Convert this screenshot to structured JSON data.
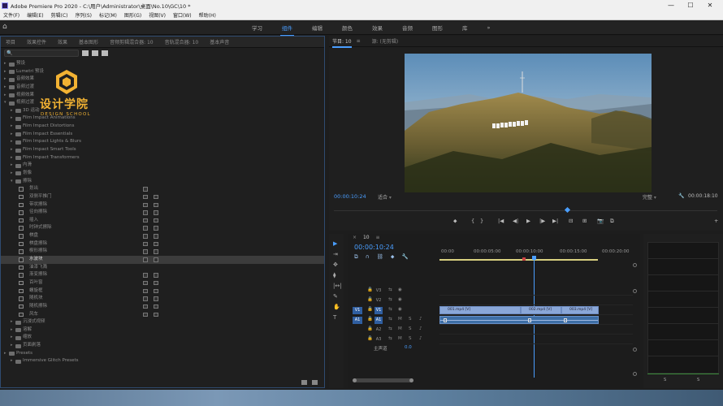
{
  "window": {
    "title": "Adobe Premiere Pro 2020 - C:\\用户\\Administrator\\桌面\\No.10\\GC\\10 *",
    "buttons": [
      "—",
      "☐",
      "✕"
    ]
  },
  "menu": [
    "文件(F)",
    "编辑(E)",
    "剪辑(C)",
    "序列(S)",
    "标记(M)",
    "图形(G)",
    "视图(V)",
    "窗口(W)",
    "帮助(H)"
  ],
  "workspaces": [
    {
      "label": "学习"
    },
    {
      "label": "组件",
      "active": true
    },
    {
      "label": "编辑"
    },
    {
      "label": "颜色"
    },
    {
      "label": "效果"
    },
    {
      "label": "音频"
    },
    {
      "label": "图形"
    },
    {
      "label": "库"
    },
    {
      "label": "»"
    }
  ],
  "effects_panel": {
    "tabs": [
      "项目",
      "效果控件",
      "效果",
      "基本图形",
      "音频剪辑混合器: 10",
      "音轨混合器: 10",
      "基本声音"
    ],
    "tree": [
      {
        "indent": 0,
        "type": "folder",
        "label": "预设"
      },
      {
        "indent": 0,
        "type": "folder",
        "label": "Lumetri 预设"
      },
      {
        "indent": 0,
        "type": "folder",
        "label": "音频效果"
      },
      {
        "indent": 0,
        "type": "folder",
        "label": "音频过渡"
      },
      {
        "indent": 0,
        "type": "folder",
        "label": "视频效果"
      },
      {
        "indent": 0,
        "type": "folder",
        "label": "视频过渡",
        "open": true
      },
      {
        "indent": 1,
        "type": "folder",
        "label": "3D 运动"
      },
      {
        "indent": 1,
        "type": "folder",
        "label": "Film Impact Animations"
      },
      {
        "indent": 1,
        "type": "folder",
        "label": "Film Impact Distortions"
      },
      {
        "indent": 1,
        "type": "folder",
        "label": "Film Impact Essentials"
      },
      {
        "indent": 1,
        "type": "folder",
        "label": "Film Impact Lights & Blurs"
      },
      {
        "indent": 1,
        "type": "folder",
        "label": "Film Impact Smart Tools"
      },
      {
        "indent": 1,
        "type": "folder",
        "label": "Film Impact Transformers"
      },
      {
        "indent": 1,
        "type": "folder",
        "label": "内滑"
      },
      {
        "indent": 1,
        "type": "folder",
        "label": "划像"
      },
      {
        "indent": 1,
        "type": "folder",
        "label": "擦除",
        "open": true
      },
      {
        "indent": 2,
        "type": "fx",
        "label": "划出",
        "badges": 1
      },
      {
        "indent": 2,
        "type": "fx",
        "label": "双侧平推门",
        "badges": 2
      },
      {
        "indent": 2,
        "type": "fx",
        "label": "带状擦除",
        "badges": 2
      },
      {
        "indent": 2,
        "type": "fx",
        "label": "径向擦除",
        "badges": 2
      },
      {
        "indent": 2,
        "type": "fx",
        "label": "插入",
        "badges": 2
      },
      {
        "indent": 2,
        "type": "fx",
        "label": "时钟式擦除",
        "badges": 2
      },
      {
        "indent": 2,
        "type": "fx",
        "label": "棋盘",
        "badges": 2
      },
      {
        "indent": 2,
        "type": "fx",
        "label": "棋盘擦除",
        "badges": 2
      },
      {
        "indent": 2,
        "type": "fx",
        "label": "楔形擦除",
        "badges": 2
      },
      {
        "indent": 2,
        "type": "fx",
        "label": "水波块",
        "badges": 2,
        "selected": true
      },
      {
        "indent": 2,
        "type": "fx",
        "label": "油漆飞溅",
        "badges": 0
      },
      {
        "indent": 2,
        "type": "fx",
        "label": "渐变擦除",
        "badges": 2
      },
      {
        "indent": 2,
        "type": "fx",
        "label": "百叶窗",
        "badges": 2
      },
      {
        "indent": 2,
        "type": "fx",
        "label": "螺旋框",
        "badges": 2
      },
      {
        "indent": 2,
        "type": "fx",
        "label": "随机块",
        "badges": 2
      },
      {
        "indent": 2,
        "type": "fx",
        "label": "随机擦除",
        "badges": 2
      },
      {
        "indent": 2,
        "type": "fx",
        "label": "风车",
        "badges": 2
      },
      {
        "indent": 1,
        "type": "folder",
        "label": "沉浸式视频"
      },
      {
        "indent": 1,
        "type": "folder",
        "label": "溶解"
      },
      {
        "indent": 1,
        "type": "folder",
        "label": "缩放"
      },
      {
        "indent": 1,
        "type": "folder",
        "label": "页面剥落"
      },
      {
        "indent": 0,
        "type": "folder",
        "label": "Presets"
      },
      {
        "indent": 1,
        "type": "folder",
        "label": "Immersive Glitch Presets"
      }
    ]
  },
  "logo": {
    "title": "设计学院",
    "subtitle": "DESIGN SCHOOL",
    "color": "#f2b233"
  },
  "program_monitor": {
    "tab_active": "节目: 10",
    "tab_menu": "≡",
    "tab_other": "源: (无剪辑)",
    "timecode": "00:00:10:24",
    "fit": "适合",
    "quality": "完整",
    "duration": "00:00:18:10",
    "playhead_fraction": 0.603,
    "controls": [
      "⬥",
      "{",
      "}",
      "|◀",
      "◀|",
      "▶",
      "|▶",
      "▶|",
      "⊟",
      "⊞",
      "📷",
      "⧉",
      "+"
    ]
  },
  "tools": [
    "▶",
    "⇥",
    "✥",
    "⧫",
    "|↔|",
    "✎",
    "✋",
    "T"
  ],
  "timeline": {
    "tab_close": "×",
    "tab_menu": "≡",
    "tab": "10",
    "timecode": "00:00:10:24",
    "ruler": [
      "00:00",
      "00:00:05:00",
      "00:00:10:00",
      "00:00:15:00",
      "00:00:20:00"
    ],
    "tracks": [
      {
        "id": "V3",
        "kind": "video"
      },
      {
        "id": "V2",
        "kind": "video"
      },
      {
        "id": "V1",
        "kind": "video",
        "target": true
      },
      {
        "id": "A1",
        "kind": "audio",
        "target": true
      },
      {
        "id": "A2",
        "kind": "audio"
      },
      {
        "id": "A3",
        "kind": "audio"
      }
    ],
    "clips": [
      "001.mp4 [V]",
      "002.mp4 [V]",
      "003.mp4 [V]"
    ],
    "master_label": "主声道",
    "master_value": "0.0"
  },
  "meters": {
    "labels": [
      "S",
      "S"
    ]
  }
}
